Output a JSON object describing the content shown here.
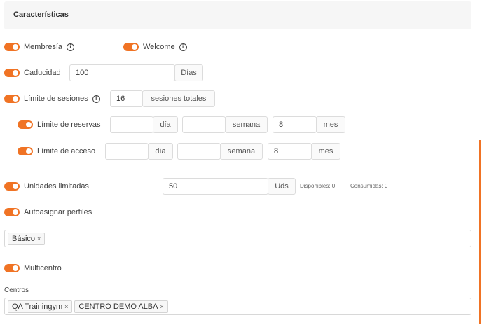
{
  "section": {
    "title": "Características"
  },
  "membresia": {
    "label": "Membresía"
  },
  "welcome": {
    "label": "Welcome"
  },
  "caducidad": {
    "label": "Caducidad",
    "value": "100",
    "unit": "Días"
  },
  "limite_sesiones": {
    "label": "Límite de sesiones",
    "value": "16",
    "unit": "sesiones totales"
  },
  "limite_reservas": {
    "label": "Límite de reservas",
    "dia_value": "",
    "dia_unit": "día",
    "semana_value": "",
    "semana_unit": "semana",
    "mes_value": "8",
    "mes_unit": "mes"
  },
  "limite_acceso": {
    "label": "Límite de acceso",
    "dia_value": "",
    "dia_unit": "día",
    "semana_value": "",
    "semana_unit": "semana",
    "mes_value": "8",
    "mes_unit": "mes"
  },
  "unidades": {
    "label": "Unidades limitadas",
    "value": "50",
    "unit": "Uds",
    "disponibles": "Disponibles: 0",
    "consumidas": "Consumidas: 0"
  },
  "autoasignar": {
    "label": "Autoasignar perfiles",
    "tags": [
      "Básico"
    ]
  },
  "multicentro": {
    "label": "Multicentro"
  },
  "centros": {
    "label": "Centros",
    "tags": [
      "QA Trainingym",
      "CENTRO DEMO ALBA"
    ]
  },
  "tag_remove_symbol": "×",
  "info_symbol": "i",
  "colors": {
    "accent": "#f07324",
    "header_bg": "#f6f6f6",
    "border": "#dcdcdc"
  }
}
